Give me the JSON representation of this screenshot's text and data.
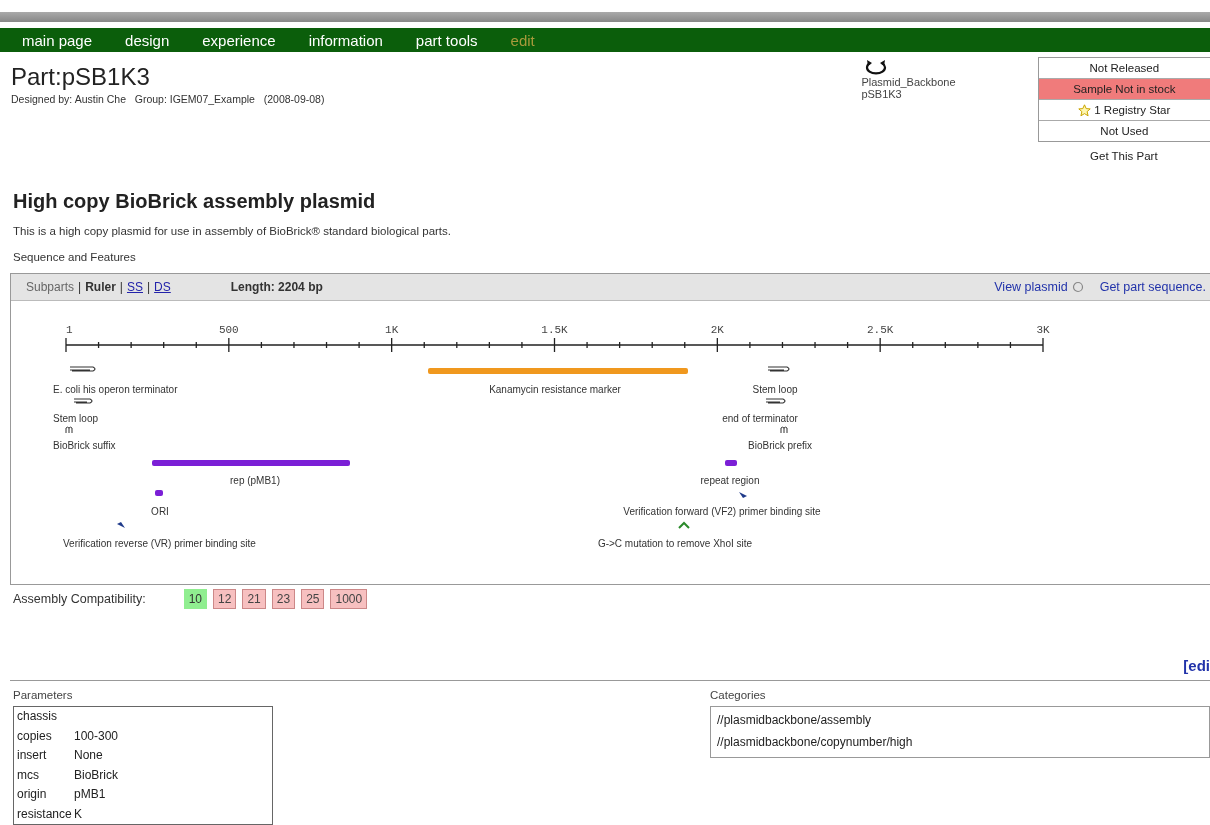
{
  "nav": {
    "items": [
      {
        "label": "main page",
        "selected": false
      },
      {
        "label": "design",
        "selected": false
      },
      {
        "label": "experience",
        "selected": false
      },
      {
        "label": "information",
        "selected": false
      },
      {
        "label": "part tools",
        "selected": false
      },
      {
        "label": "edit",
        "selected": true
      }
    ]
  },
  "part": {
    "title": "Part:pSB1K3",
    "designed_by": "Designed by: Austin Che   Group: IGEM07_Example   (2008-09-08)",
    "type": "Plasmid_Backbone",
    "name": "pSB1K3"
  },
  "status": {
    "rows": [
      {
        "label": "Not Released",
        "kind": "plain"
      },
      {
        "label": "Sample Not in stock",
        "kind": "alert"
      },
      {
        "label": "1 Registry Star",
        "kind": "star"
      },
      {
        "label": "Not Used",
        "kind": "plain"
      }
    ],
    "get_part": "Get This Part"
  },
  "heading": "High copy BioBrick assembly plasmid",
  "description": "This is a high copy plasmid for use in assembly of BioBrick® standard biological parts.",
  "sequence": {
    "title": "Sequence and Features",
    "separator": "|",
    "views": [
      {
        "label": "Subparts",
        "kind": "text"
      },
      {
        "label": "Ruler",
        "kind": "current"
      },
      {
        "label": "SS",
        "kind": "link"
      },
      {
        "label": "DS",
        "kind": "link"
      }
    ],
    "length": "Length: 2204 bp",
    "view_plasmid": "View plasmid",
    "get_sequence": "Get part sequence.",
    "ruler": [
      "1",
      "500",
      "1K",
      "1.5K",
      "2K",
      "2.5K",
      "3K"
    ],
    "features": [
      {
        "kind": "arrow",
        "label": "E. coli his operon terminator"
      },
      {
        "kind": "arrow",
        "label": "Stem loop"
      },
      {
        "kind": "site",
        "label": "BioBrick suffix"
      },
      {
        "kind": "bar",
        "label": "rep (pMB1)",
        "color": "#7b1fd6"
      },
      {
        "kind": "bar",
        "label": "ORI",
        "color": "#7b1fd6"
      },
      {
        "kind": "primer",
        "label": "Verification reverse (VR) primer binding site"
      },
      {
        "kind": "bar",
        "label": "Kanamycin resistance marker",
        "color": "#f0981e"
      },
      {
        "kind": "arrow",
        "label": "Stem loop"
      },
      {
        "kind": "arrow",
        "label": "end of terminator"
      },
      {
        "kind": "site",
        "label": "BioBrick prefix"
      },
      {
        "kind": "bar",
        "label": "repeat region",
        "color": "#7b1fd6"
      },
      {
        "kind": "primer",
        "label": "Verification forward (VF2) primer binding site"
      },
      {
        "kind": "mutation",
        "label": "G->C mutation to remove XhoI site"
      }
    ]
  },
  "assembly": {
    "label": "Assembly Compatibility:",
    "standards": [
      {
        "label": "10",
        "compatible": true
      },
      {
        "label": "12",
        "compatible": false
      },
      {
        "label": "21",
        "compatible": false
      },
      {
        "label": "23",
        "compatible": false
      },
      {
        "label": "25",
        "compatible": false
      },
      {
        "label": "1000",
        "compatible": false
      }
    ]
  },
  "edit_link": "[edi",
  "parameters": {
    "title": "Parameters",
    "rows": [
      {
        "name": "chassis"
      },
      {
        "name": "copies",
        "value": "100-300"
      },
      {
        "name": "insert",
        "value": "None"
      },
      {
        "name": "mcs",
        "value": "BioBrick"
      },
      {
        "name": "origin",
        "value": "pMB1"
      },
      {
        "name": "resistance",
        "value": "K"
      }
    ]
  },
  "categories": {
    "title": "Categories",
    "items": [
      "//plasmidbackbone/assembly",
      "//plasmidbackbone/copynumber/high"
    ]
  }
}
